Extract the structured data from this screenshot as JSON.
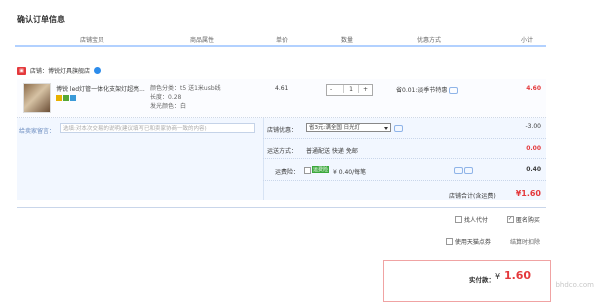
{
  "page_title": "确认订单信息",
  "header": [
    "店铺宝贝",
    "商品属性",
    "单价",
    "数量",
    "优惠方式",
    "小计"
  ],
  "shop": {
    "label": "店铺：",
    "name": "博锐灯具旗舰店"
  },
  "item": {
    "title": "博锐 led灯管一体化支架灯超亮...",
    "sku_lines": [
      "颜色分类：t5 送1米usb线",
      "长度：0.28",
      "发光颜色：白"
    ],
    "price": "4.61",
    "qty": "1",
    "qty_minus": "-",
    "qty_plus": "+",
    "promo": "省0.01:淡季节特惠",
    "subtotal": "4.60"
  },
  "message": {
    "label": "给卖家留言：",
    "placeholder": "选填:对本次交易的说明(建议填写已和卖家协商一致的内容)"
  },
  "shop_coupon": {
    "label": "店铺优惠：",
    "value": "省3元:满全国 日光灯",
    "amount": "-3.00"
  },
  "shipping": {
    "label": "运送方式：",
    "value": "普通配送 快递 免邮",
    "amount": "0.00"
  },
  "insurance": {
    "label": "运费险：",
    "tag": "运费险",
    "value": "¥ 0.40/每笔",
    "amount": "0.40"
  },
  "shop_total": {
    "label": "店铺合计(含运费)",
    "value": "¥1.60"
  },
  "options": {
    "pay_for_friend": "找人代付",
    "anonymous": "匿名购买",
    "use_points": "使用天猫点券",
    "points_info": "结算时扣除"
  },
  "payment": {
    "label": "实付款：",
    "currency": "¥",
    "value": "1.60"
  },
  "watermark": "bhdco.com"
}
